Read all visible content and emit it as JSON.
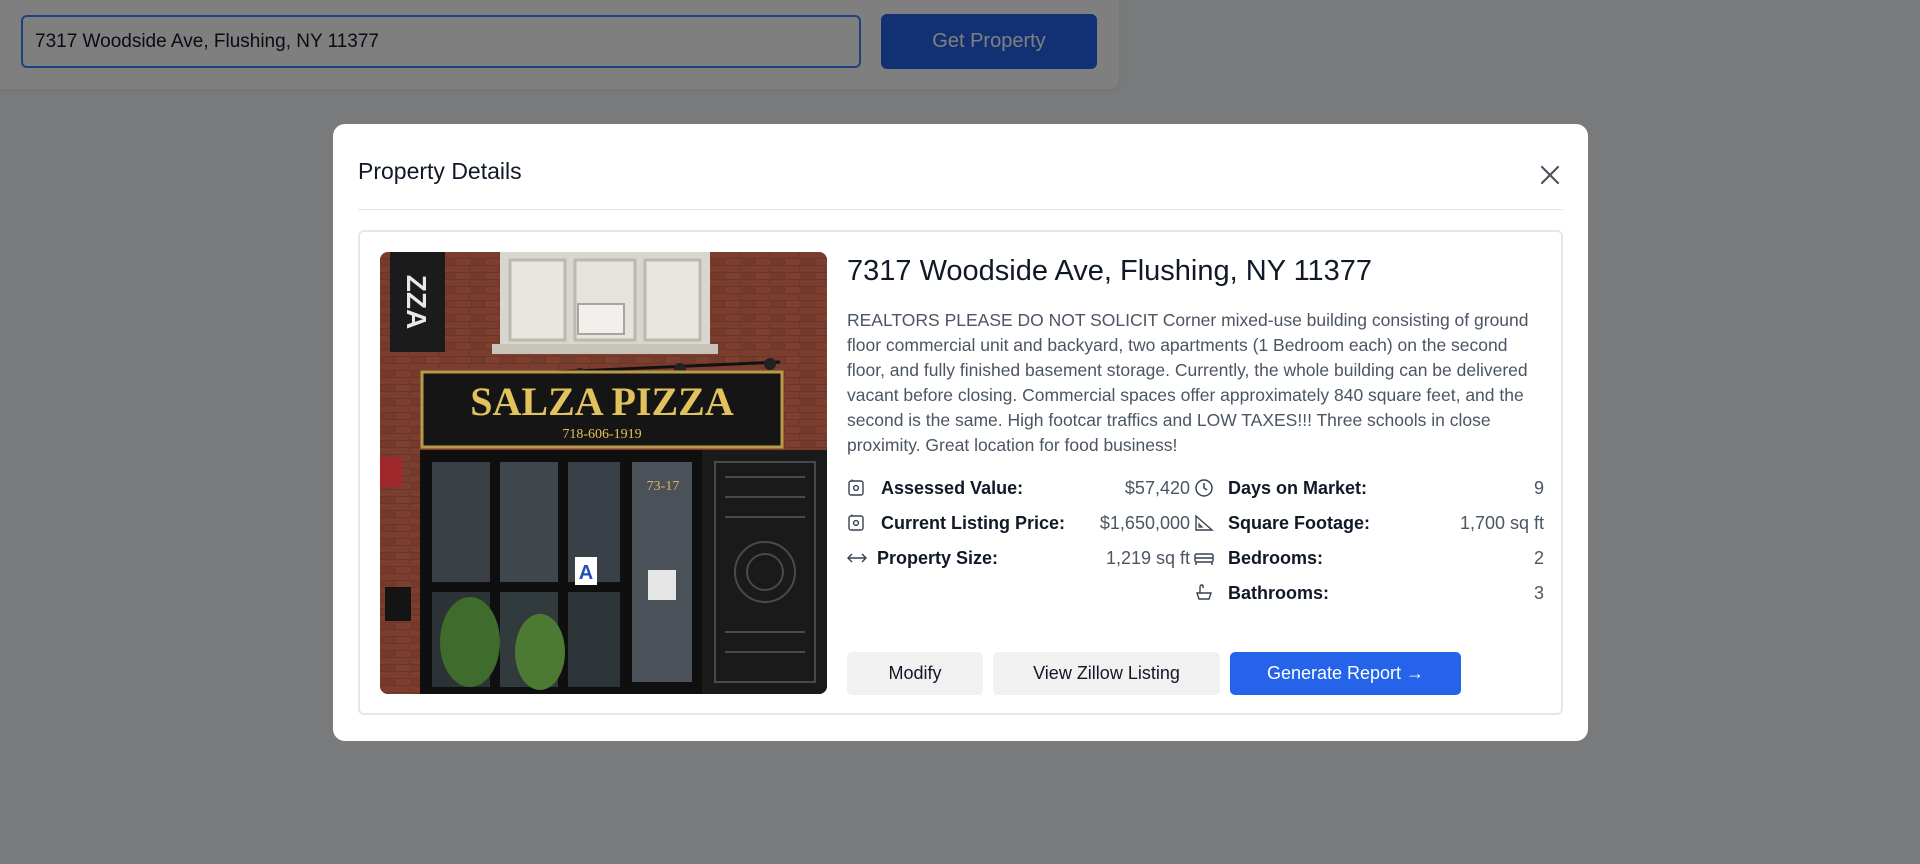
{
  "search": {
    "value": "7317 Woodside Ave, Flushing, NY 11377",
    "button_label": "Get Property"
  },
  "modal": {
    "title": "Property Details",
    "close_icon": "close-icon"
  },
  "property": {
    "address": "7317 Woodside Ave, Flushing, NY 11377",
    "description": "REALTORS PLEASE DO NOT SOLICIT Corner mixed-use building consisting of ground floor commercial unit and backyard, two apartments (1 Bedroom each) on the second floor, and fully finished basement storage. Currently, the whole building can be delivered vacant before closing. Commercial spaces offer approximately 840 square feet, and the second is the same. High footcar traffics and LOW TAXES!!! Three schools in close proximity. Great location for food business!",
    "photo": {
      "sign_text": "SALZA PIZZA",
      "sign_phone": "718-606-1919",
      "door_number": "73-17",
      "rating_letter": "A"
    },
    "stats_left": [
      {
        "icon": "dollar-tag-icon",
        "label": "Assessed Value:",
        "value": "$57,420"
      },
      {
        "icon": "dollar-tag-icon",
        "label": "Current Listing Price:",
        "value": "$1,650,000"
      },
      {
        "icon": "arrows-horizontal-icon",
        "label": "Property Size:",
        "value": "1,219 sq ft"
      }
    ],
    "stats_right": [
      {
        "icon": "clock-icon",
        "label": "Days on Market:",
        "value": "9"
      },
      {
        "icon": "ruler-triangle-icon",
        "label": "Square Footage:",
        "value": "1,700 sq ft"
      },
      {
        "icon": "bed-icon",
        "label": "Bedrooms:",
        "value": "2"
      },
      {
        "icon": "bath-icon",
        "label": "Bathrooms:",
        "value": "3"
      }
    ]
  },
  "actions": {
    "modify": "Modify",
    "zillow": "View Zillow Listing",
    "report": "Generate Report →"
  },
  "colors": {
    "primary": "#2563eb",
    "input_border": "#3b82f6",
    "overlay": "rgba(0,0,0,0.5)"
  }
}
